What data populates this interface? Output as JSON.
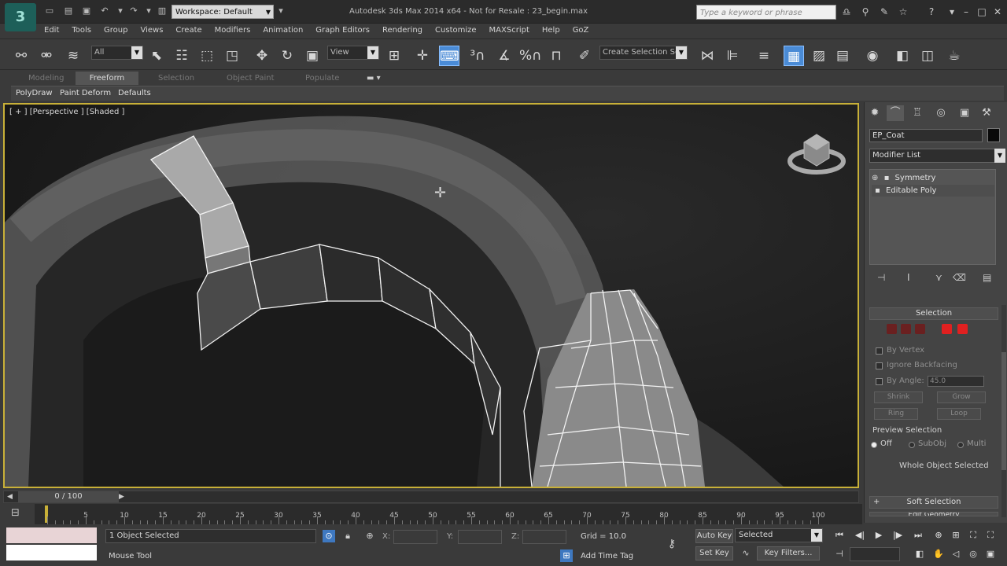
{
  "app": {
    "logo_text": "3",
    "window_title": "Autodesk 3ds Max  2014 x64    - Not for Resale :  23_begin.max",
    "workspace": "Workspace: Default",
    "search_placeholder": "Type a keyword or phrase"
  },
  "menu": [
    "Edit",
    "Tools",
    "Group",
    "Views",
    "Create",
    "Modifiers",
    "Animation",
    "Graph Editors",
    "Rendering",
    "Customize",
    "MAXScript",
    "Help",
    "GoZ"
  ],
  "toolbar": {
    "selection_filter": "All",
    "ref_coord": "View",
    "named_selection_placeholder": "Create Selection Se"
  },
  "ribbon": {
    "tabs": [
      "Modeling",
      "Freeform",
      "Selection",
      "Object Paint",
      "Populate"
    ],
    "active_tab": "Freeform",
    "subtabs": [
      "PolyDraw",
      "Paint Deform",
      "Defaults"
    ]
  },
  "viewport": {
    "label": "[ + ] [Perspective ] [Shaded ]"
  },
  "command_panel": {
    "object_name": "EP_Coat",
    "object_color": "#000000",
    "modifier_list": "Modifier List",
    "stack": [
      "Symmetry",
      "Editable Poly"
    ],
    "selection_rollout": "Selection",
    "options": [
      "By Vertex",
      "Ignore Backfacing",
      "By Angle:"
    ],
    "angle_value": "45.0",
    "buttons": [
      "Shrink",
      "Grow",
      "Ring",
      "Loop"
    ],
    "preview_title": "Preview Selection",
    "preview_options": [
      "Off",
      "SubObj",
      "Multi"
    ],
    "status": "Whole Object Selected",
    "soft_selection": "Soft Selection",
    "edit_geometry": "Edit Geometry"
  },
  "timeline": {
    "frame_display": "0 / 100",
    "ticks": [
      5,
      10,
      15,
      20,
      25,
      30,
      35,
      40,
      45,
      50,
      55,
      60,
      65,
      70,
      75,
      80,
      85,
      90,
      95,
      100
    ],
    "current_frame": 0,
    "max_frame": 100
  },
  "status": {
    "selection_text": "1 Object Selected",
    "prompt": "Mouse Tool",
    "axes": [
      "X:",
      "Y:",
      "Z:"
    ],
    "grid": "Grid = 10.0",
    "auto_key": "Auto Key",
    "set_key": "Set Key",
    "key_mode": "Selected",
    "key_filters": "Key Filters...",
    "add_time_tag": "Add Time Tag",
    "swatch_color": "#e8d4d6"
  }
}
